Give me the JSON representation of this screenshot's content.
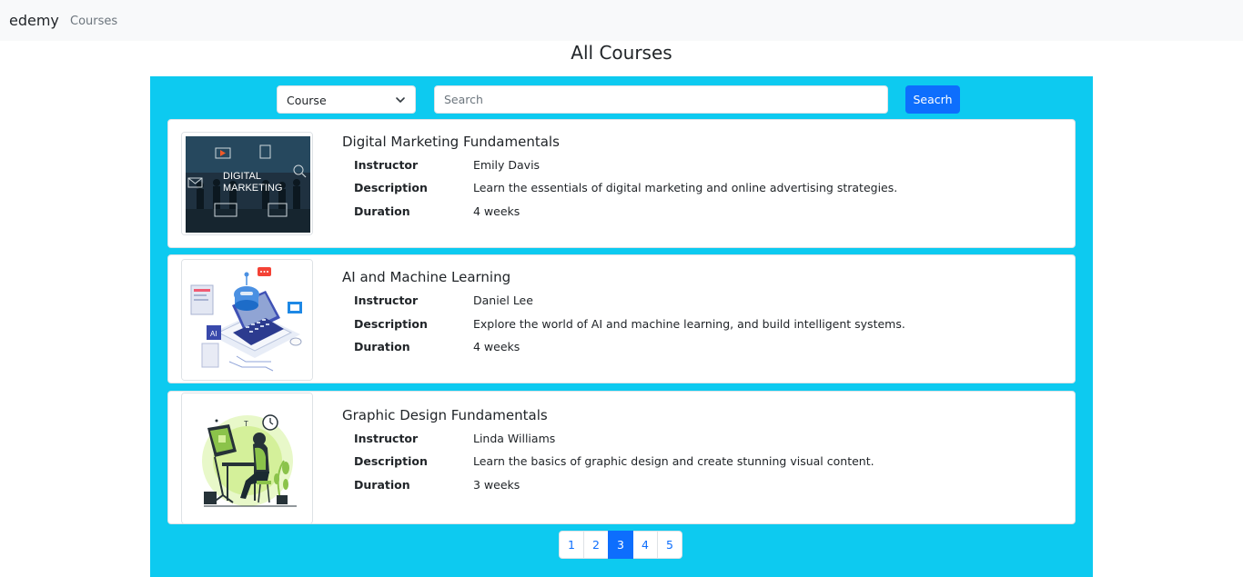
{
  "navbar": {
    "brand": "edemy",
    "links": [
      "Courses"
    ]
  },
  "page_title": "All Courses",
  "filter": {
    "select_value": "Course",
    "search_placeholder": "Search",
    "search_button": "Seacrh"
  },
  "labels": {
    "instructor": "Instructor",
    "description": "Description",
    "duration": "Duration"
  },
  "courses": [
    {
      "title": "Digital Marketing Fundamentals",
      "instructor": "Emily Davis",
      "description": "Learn the essentials of digital marketing and online advertising strategies.",
      "duration": "4 weeks",
      "image_text": [
        "DIGITAL",
        "MARKETING"
      ]
    },
    {
      "title": "AI and Machine Learning",
      "instructor": "Daniel Lee",
      "description": "Explore the world of AI and machine learning, and build intelligent systems.",
      "duration": "4 weeks"
    },
    {
      "title": "Graphic Design Fundamentals",
      "instructor": "Linda Williams",
      "description": "Learn the basics of graphic design and create stunning visual content.",
      "duration": "3 weeks"
    }
  ],
  "pagination": {
    "pages": [
      "1",
      "2",
      "3",
      "4",
      "5"
    ],
    "active": "3"
  },
  "colors": {
    "panel": "#0dcaf0",
    "primary": "#0d6efd",
    "navbar": "#f8f9fa"
  }
}
